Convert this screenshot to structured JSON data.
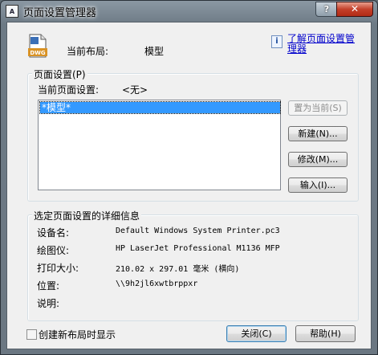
{
  "window": {
    "title": "页面设置管理器",
    "app_icon_text": "A",
    "help_button_glyph": "?",
    "close_button_glyph": "✕"
  },
  "header": {
    "current_layout_label": "当前布局:",
    "current_layout_value": "模型",
    "dwg_icon_text": "DWG",
    "info_icon_glyph": "i",
    "learn_link": "了解页面设置管理器"
  },
  "page_setups": {
    "group_title": "页面设置(P)",
    "current_label": "当前页面设置:",
    "current_value": "<无>",
    "items": [
      "*模型*"
    ],
    "buttons": {
      "set_current": "置为当前(S)",
      "new": "新建(N)...",
      "modify": "修改(M)...",
      "import": "输入(I)..."
    }
  },
  "details": {
    "group_title": "选定页面设置的详细信息",
    "device_label": "设备名:",
    "device_value": "Default Windows System Printer.pc3",
    "plotter_label": "绘图仪:",
    "plotter_value": "HP LaserJet Professional M1136 MFP",
    "size_label": "打印大小:",
    "size_value": "210.02 x 297.01 毫米 (横向)",
    "location_label": "位置:",
    "location_value": "\\\\9h2jl6xwtbrppxr",
    "description_label": "说明:"
  },
  "footer": {
    "show_on_new_layout_label": "创建新布局时显示",
    "show_on_new_layout_checked": false,
    "close_button": "关闭(C)",
    "help_button": "帮助(H)"
  }
}
